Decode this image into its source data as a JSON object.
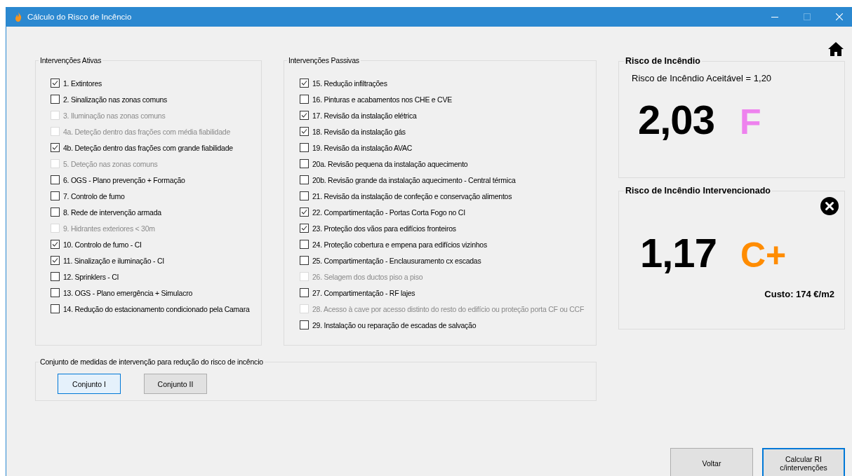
{
  "window": {
    "title": "Cálculo do Risco de Incêncio"
  },
  "active_group": {
    "title": "Intervenções Ativas",
    "items": [
      {
        "label": "1. Extintores",
        "checked": true,
        "disabled": false
      },
      {
        "label": "2. Sinalização nas zonas comuns",
        "checked": false,
        "disabled": false
      },
      {
        "label": "3. Iluminação nas zonas comuns",
        "checked": false,
        "disabled": true
      },
      {
        "label": "4a. Deteção dentro das frações com média fiabilidade",
        "checked": false,
        "disabled": true
      },
      {
        "label": "4b. Deteção dentro das frações com grande fiabilidade",
        "checked": true,
        "disabled": false
      },
      {
        "label": "5. Deteção nas zonas comuns",
        "checked": false,
        "disabled": true
      },
      {
        "label": "6. OGS - Plano prevenção + Formação",
        "checked": false,
        "disabled": false
      },
      {
        "label": "7. Controlo de fumo",
        "checked": false,
        "disabled": false
      },
      {
        "label": "8. Rede de intervenção armada",
        "checked": false,
        "disabled": false
      },
      {
        "label": "9. Hidrantes exteriores < 30m",
        "checked": false,
        "disabled": true
      },
      {
        "label": "10. Controlo de fumo - CI",
        "checked": true,
        "disabled": false
      },
      {
        "label": "11. Sinalização e iluminação - CI",
        "checked": true,
        "disabled": false
      },
      {
        "label": "12. Sprinklers - CI",
        "checked": false,
        "disabled": false
      },
      {
        "label": "13. OGS - Plano emergência + Simulacro",
        "checked": false,
        "disabled": false
      },
      {
        "label": "14. Redução do estacionamento condicionado pela Camara",
        "checked": false,
        "disabled": false
      }
    ]
  },
  "passive_group": {
    "title": "Intervenções Passivas",
    "items": [
      {
        "label": "15. Redução infiltrações",
        "checked": true,
        "disabled": false
      },
      {
        "label": "16. Pinturas e acabamentos nos CHE e CVE",
        "checked": false,
        "disabled": false
      },
      {
        "label": "17. Revisão da instalação elétrica",
        "checked": true,
        "disabled": false
      },
      {
        "label": "18. Revisão da instalação gás",
        "checked": true,
        "disabled": false
      },
      {
        "label": "19. Revisão da instalação AVAC",
        "checked": false,
        "disabled": false
      },
      {
        "label": "20a. Revisão pequena da instalação aquecimento",
        "checked": false,
        "disabled": false
      },
      {
        "label": "20b. Revisão grande da instalação aquecimento - Central térmica",
        "checked": false,
        "disabled": false
      },
      {
        "label": "21. Revisão da instalação de confeção e conservação alimentos",
        "checked": false,
        "disabled": false
      },
      {
        "label": "22. Compartimentação - Portas Corta Fogo no CI",
        "checked": true,
        "disabled": false
      },
      {
        "label": "23. Proteção dos vãos para edifícios fronteiros",
        "checked": true,
        "disabled": false
      },
      {
        "label": "24. Proteção cobertura e empena para edifícios vizinhos",
        "checked": false,
        "disabled": false
      },
      {
        "label": "25. Compartimentação - Enclausuramento cx escadas",
        "checked": false,
        "disabled": false
      },
      {
        "label": "26. Selagem dos ductos piso a piso",
        "checked": false,
        "disabled": true
      },
      {
        "label": "27. Compartimentação - RF lajes",
        "checked": false,
        "disabled": false
      },
      {
        "label": "28. Acesso à cave por acesso distinto do resto do edifício ou proteção porta CF ou CCF",
        "checked": false,
        "disabled": true
      },
      {
        "label": "29. Instalação ou reparação de escadas de salvação",
        "checked": false,
        "disabled": false
      }
    ]
  },
  "sets_group": {
    "title": "Conjunto de medidas de intervenção para redução do risco de incêncio",
    "buttons": [
      {
        "label": "Conjunto I",
        "selected": true
      },
      {
        "label": "Conjunto II",
        "selected": false
      }
    ]
  },
  "risk_panel": {
    "title": "Risco de Incêndio",
    "acceptable": "Risco de Incêndio Aceitável = 1,20",
    "value": "2,03",
    "grade": "F",
    "color": "#ee82ee"
  },
  "intervened_panel": {
    "title": "Risco de Incêndio Intervencionado",
    "value": "1,17",
    "grade": "C+",
    "color": "#ff8c00",
    "cost": "Custo: 174 €/m2"
  },
  "footer_buttons": [
    {
      "label": "Voltar",
      "focused": false
    },
    {
      "label": "Calcular RI c/intervenções",
      "focused": true
    }
  ]
}
